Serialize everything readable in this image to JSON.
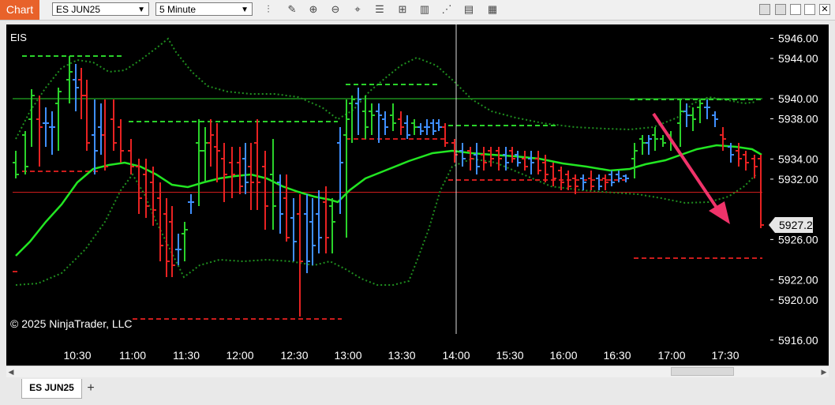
{
  "window": {
    "app_tab": "Chart",
    "instrument": "ES JUN25",
    "interval": "5 Minute",
    "bottom_tab": "ES JUN25",
    "add_tab": "+"
  },
  "chart_data": {
    "type": "ohlc",
    "symbol_label": "EIS",
    "copyright": "© 2025 NinjaTrader, LLC",
    "x_tick_labels": [
      "10:30",
      "11:00",
      "11:30",
      "12:00",
      "12:30",
      "13:00",
      "13:30",
      "14:00",
      "15:30",
      "16:00",
      "16:30",
      "17:00",
      "17:30"
    ],
    "y_tick_labels": [
      "5946.00",
      "5944.00",
      "5940.00",
      "5938.00",
      "5934.00",
      "5932.00",
      "5926.00",
      "5922.00",
      "5920.00",
      "5916.00"
    ],
    "price_marker": "5927.25",
    "ylim": [
      5914.3,
      5947.0
    ],
    "colors": {
      "up": "#2ad22a",
      "down": "#e82222",
      "neutral": "#3f8fff",
      "ma": "#22e622",
      "bands": "#1f8f1f",
      "hline_green": "#2ad22a",
      "hline_red": "#cc1c1c",
      "arrow": "#f0336a"
    },
    "horizontal_lines": [
      {
        "price": 5940.0,
        "color": "green"
      },
      {
        "price": 5930.7,
        "color": "red"
      }
    ]
  }
}
